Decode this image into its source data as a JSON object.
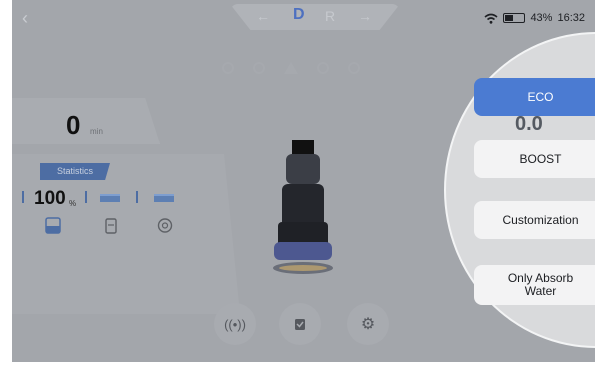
{
  "topbar": {
    "gears": [
      "←",
      "D",
      "R",
      "→"
    ],
    "active_gear": "D",
    "battery_percent": "43%",
    "battery_level": 0.43,
    "time": "16:32"
  },
  "speed": {
    "value": "0",
    "unit": "min"
  },
  "statistics": {
    "tab_label": "Statistics",
    "percent": "100",
    "percent_unit": "%"
  },
  "mode_menu": {
    "ghost_speed": "0.0",
    "options": [
      "ECO",
      "BOOST",
      "Customization",
      "Only Absorb Water"
    ],
    "selected": "ECO"
  },
  "icons": {
    "back": "chevron-left-icon",
    "wifi": "wifi-icon",
    "battery": "battery-icon",
    "bottom": [
      "signal-icon",
      "clipboard-icon",
      "settings-icon"
    ]
  },
  "colors": {
    "accent": "#4b7bd2",
    "stats_tab": "#4d6da3"
  }
}
